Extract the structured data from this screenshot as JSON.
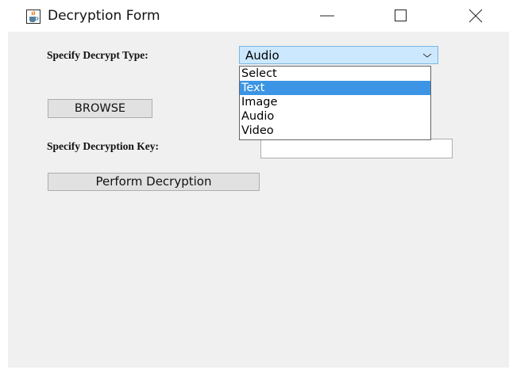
{
  "window": {
    "title": "Decryption Form",
    "icon": "java-cup-icon",
    "controls": [
      "minimize",
      "maximize",
      "close"
    ]
  },
  "form": {
    "decrypt_type_label": "Specify Decrypt Type:",
    "decrypt_type": {
      "selected": "Audio",
      "options": [
        "Select",
        "Text",
        "Image",
        "Audio",
        "Video"
      ],
      "highlighted": "Text"
    },
    "browse_label": "BROWSE",
    "key_label": "Specify Decryption Key:",
    "key_value": "",
    "perform_label": "Perform Decryption"
  },
  "colors": {
    "client_bg": "#f0f0f0",
    "combo_bg": "#cce8ff",
    "highlight": "#3c95e4"
  }
}
